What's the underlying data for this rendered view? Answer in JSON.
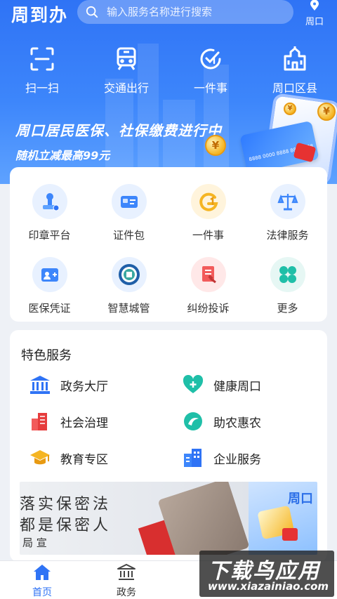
{
  "header": {
    "app_title": "周到办",
    "search_placeholder": "输入服务名称进行搜索",
    "location": "周口"
  },
  "quick_actions": [
    {
      "label": "扫一扫",
      "icon": "scan-icon"
    },
    {
      "label": "交通出行",
      "icon": "train-icon"
    },
    {
      "label": "一件事",
      "icon": "one-thing-icon"
    },
    {
      "label": "周口区县",
      "icon": "building-icon"
    }
  ],
  "banner": {
    "title": "周口居民医保、社保缴费进行中",
    "subtitle": "随机立减最高99元",
    "card_number": "8888 0000 8888 8888 888"
  },
  "service_grid": [
    {
      "label": "印章平台",
      "icon": "seal-icon"
    },
    {
      "label": "证件包",
      "icon": "id-card-icon"
    },
    {
      "label": "一件事",
      "icon": "one-thing-icon"
    },
    {
      "label": "法律服务",
      "icon": "scales-icon"
    },
    {
      "label": "医保凭证",
      "icon": "medical-card-icon"
    },
    {
      "label": "智慧城管",
      "icon": "city-badge-icon"
    },
    {
      "label": "纠纷投诉",
      "icon": "complaint-icon"
    },
    {
      "label": "更多",
      "icon": "more-icon"
    }
  ],
  "featured": {
    "title": "特色服务",
    "items": [
      {
        "label": "政务大厅",
        "icon": "government-hall-icon"
      },
      {
        "label": "健康周口",
        "icon": "health-heart-icon"
      },
      {
        "label": "社会治理",
        "icon": "buildings-icon"
      },
      {
        "label": "助农惠农",
        "icon": "agriculture-icon"
      },
      {
        "label": "教育专区",
        "icon": "graduation-cap-icon"
      },
      {
        "label": "企业服务",
        "icon": "enterprise-icon"
      }
    ],
    "banner_lines": [
      "落实保密法",
      "都是保密人",
      "局 宣"
    ],
    "banner_right": "周口"
  },
  "tabbar": [
    {
      "label": "首页",
      "active": true
    },
    {
      "label": "政务",
      "active": false
    }
  ],
  "watermark": {
    "title": "下载鸟应用",
    "url": "www.xiazainiao.com"
  },
  "colors": {
    "primary": "#2f73f5",
    "active_tab": "#2f73f5",
    "grid_icon_bg": "#e8f1ff"
  }
}
